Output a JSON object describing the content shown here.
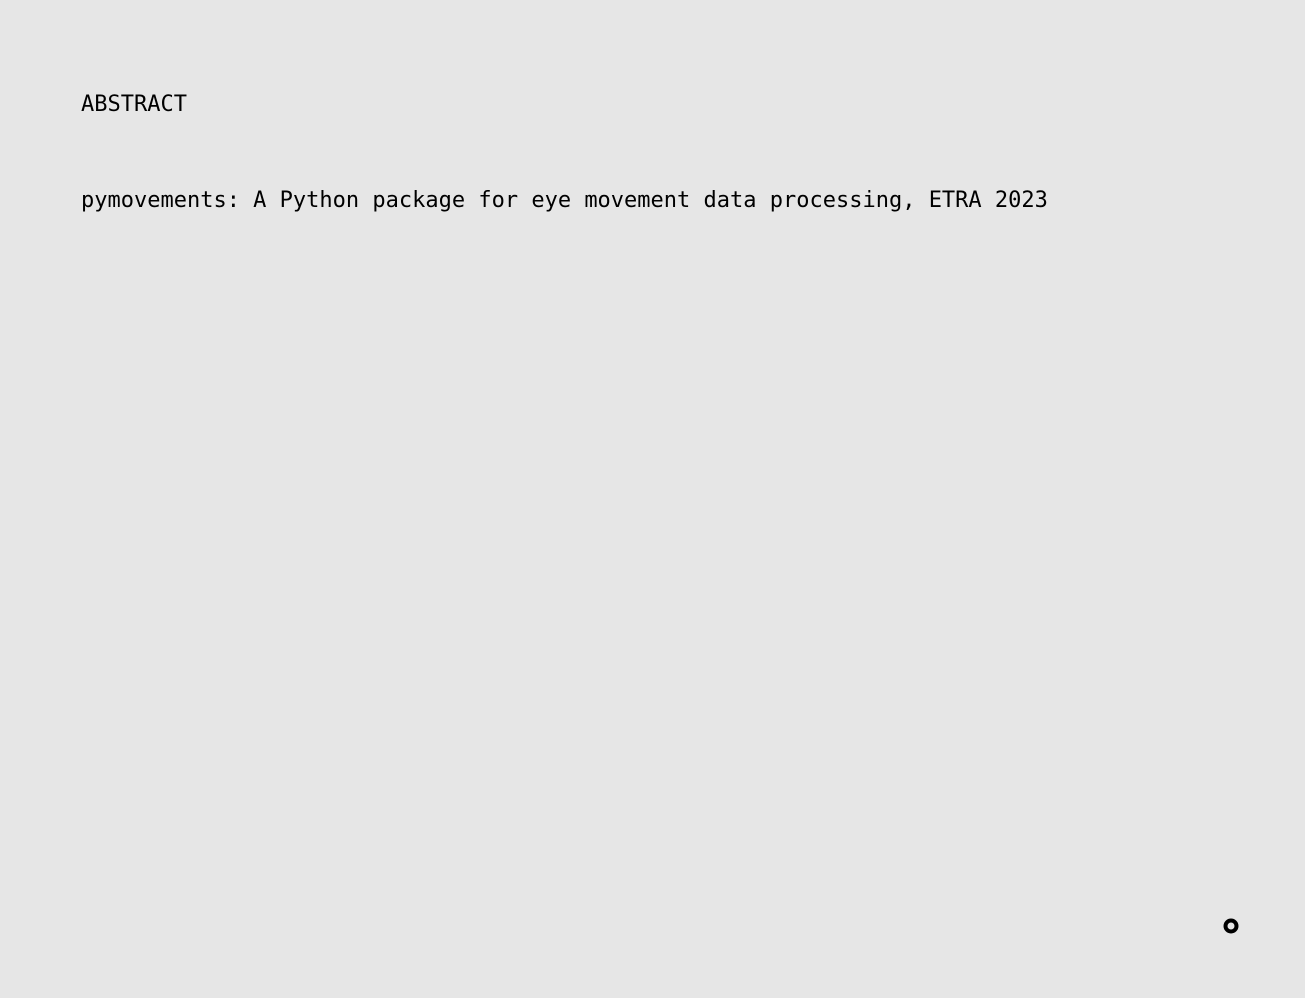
{
  "section": {
    "label": "ABSTRACT"
  },
  "entries": [
    {
      "title": "pymovements: A Python package for eye movement data processing, ETRA 2023"
    }
  ],
  "widget": {
    "icon": "ring-icon",
    "color": "#000000"
  },
  "theme": {
    "background": "#e6e6e6",
    "text": "#000000"
  }
}
